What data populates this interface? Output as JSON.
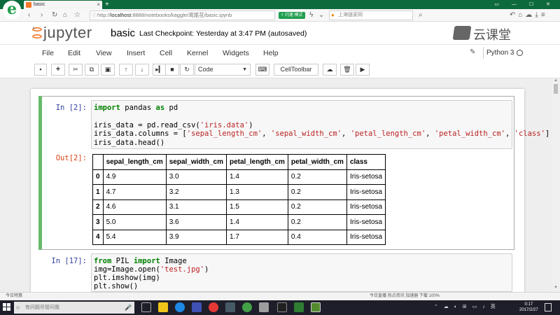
{
  "browser": {
    "tab_title": "basic",
    "tab_close": "×",
    "new_tab": "+",
    "address_host": "localhost",
    "address_rest": ":8888/notebooks/kaggle/鸢尾花/basic.ipynb",
    "address_prefix": "http://",
    "accel_badge": "⚡ 闪速 模式",
    "search_text": "上海链家网",
    "status_left": "今日特惠",
    "status_right": "今日直播   热点资讯   加速器   下载   100%"
  },
  "jupyter": {
    "logo_text": "jupyter",
    "notebook_name": "basic",
    "checkpoint": "Last Checkpoint: Yesterday at 3:47 PM (autosaved)",
    "watermark": "云课堂",
    "menu": [
      "File",
      "Edit",
      "View",
      "Insert",
      "Cell",
      "Kernel",
      "Widgets",
      "Help"
    ],
    "kernel_name": "Python 3",
    "cell_type": "Code",
    "celltoolbar_label": "CellToolbar"
  },
  "cells": [
    {
      "in_prompt": "In [2]:",
      "out_prompt": "Out[2]:",
      "code": {
        "l1_kw": "import",
        "l1_mid": " pandas ",
        "l1_kw2": "as",
        "l1_end": " pd",
        "l2_a": "iris_data = pd.read_csv(",
        "l2_str": "'iris.data'",
        "l2_b": ")",
        "l3_a": "iris_data.columns = [",
        "l3_s1": "'sepal_length_cm'",
        "l3_s2": "'sepal_width_cm'",
        "l3_s3": "'petal_length_cm'",
        "l3_s4": "'petal_width_cm'",
        "l3_s5": "'class'",
        "l3_b": "]",
        "l4": "iris_data.head()"
      },
      "table": {
        "columns": [
          "sepal_length_cm",
          "sepal_width_cm",
          "petal_length_cm",
          "petal_width_cm",
          "class"
        ],
        "rows": [
          [
            "0",
            "4.9",
            "3.0",
            "1.4",
            "0.2",
            "Iris-setosa"
          ],
          [
            "1",
            "4.7",
            "3.2",
            "1.3",
            "0.2",
            "Iris-setosa"
          ],
          [
            "2",
            "4.6",
            "3.1",
            "1.5",
            "0.2",
            "Iris-setosa"
          ],
          [
            "3",
            "5.0",
            "3.6",
            "1.4",
            "0.2",
            "Iris-setosa"
          ],
          [
            "4",
            "5.4",
            "3.9",
            "1.7",
            "0.4",
            "Iris-setosa"
          ]
        ]
      }
    },
    {
      "in_prompt": "In [17]:",
      "code": {
        "l1_kw": "from",
        "l1_mid": " PIL ",
        "l1_kw2": "import",
        "l1_end": " Image",
        "l2_a": "img=Image.open(",
        "l2_str": "'test.jpg'",
        "l2_b": ")",
        "l3": "plt.imshow(img)",
        "l4": "plt.show()"
      }
    }
  ],
  "taskbar": {
    "search_placeholder": "有问题尽管问我",
    "clock_time": "0:17",
    "clock_date": "2017/2/27"
  },
  "colors": {
    "cell_selected_border": "#66bb6a",
    "prompt_in": "#303f9f",
    "prompt_out": "#d84315",
    "keyword": "#008000",
    "string": "#ba2121",
    "browser_green": "#0d6a3c"
  }
}
